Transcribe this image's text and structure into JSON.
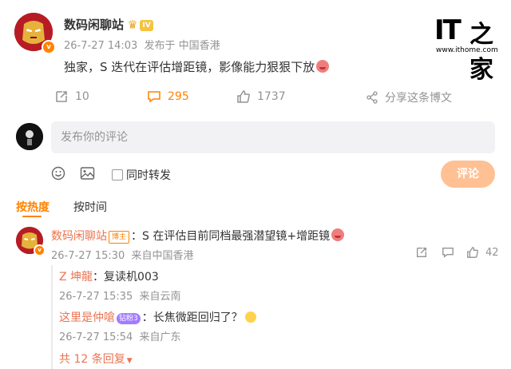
{
  "logo": {
    "mark": "IT",
    "char": "之家",
    "url": "www.ithome.com"
  },
  "post": {
    "username": "数码闲聊站",
    "level_badge": "IV",
    "date": "26-7-27 14:03",
    "location": "发布于 中国香港",
    "text": "独家，S 迭代在评估增距镜，影像能力狠狠下放",
    "actions": {
      "share_count": "10",
      "comment_count": "295",
      "like_count": "1737",
      "share_label": "分享这条博文"
    }
  },
  "composer": {
    "placeholder": "发布你的评论",
    "forward_label": "同时转发",
    "submit_label": "评论"
  },
  "sort": {
    "hot_label": "按热度",
    "time_label": "按时间"
  },
  "comment": {
    "username": "数码闲聊站",
    "host_badge": "博主",
    "text": "：S 在评估目前同档最强潜望镜+增距镜",
    "date": "26-7-27 15:30",
    "location": "来自中国香港",
    "like_count": "42"
  },
  "replies": [
    {
      "username": "Z 坤龍",
      "text": "：复读机003",
      "date": "26-7-27 15:35",
      "location": "来自云南",
      "badge": ""
    },
    {
      "username": "这里是仲嗆",
      "text": "：长焦微距回归了？",
      "date": "26-7-27 15:54",
      "location": "来自广东",
      "badge": "钻粉3"
    }
  ],
  "more_replies": "共 12 条回复",
  "colors": {
    "accent": "#ff8200",
    "link": "#eb7350",
    "submit_disabled": "#ffc093"
  },
  "icons": [
    "forward-icon",
    "comment-icon",
    "like-icon",
    "share-icon",
    "emoji-icon",
    "image-icon",
    "chevron-down-icon"
  ]
}
